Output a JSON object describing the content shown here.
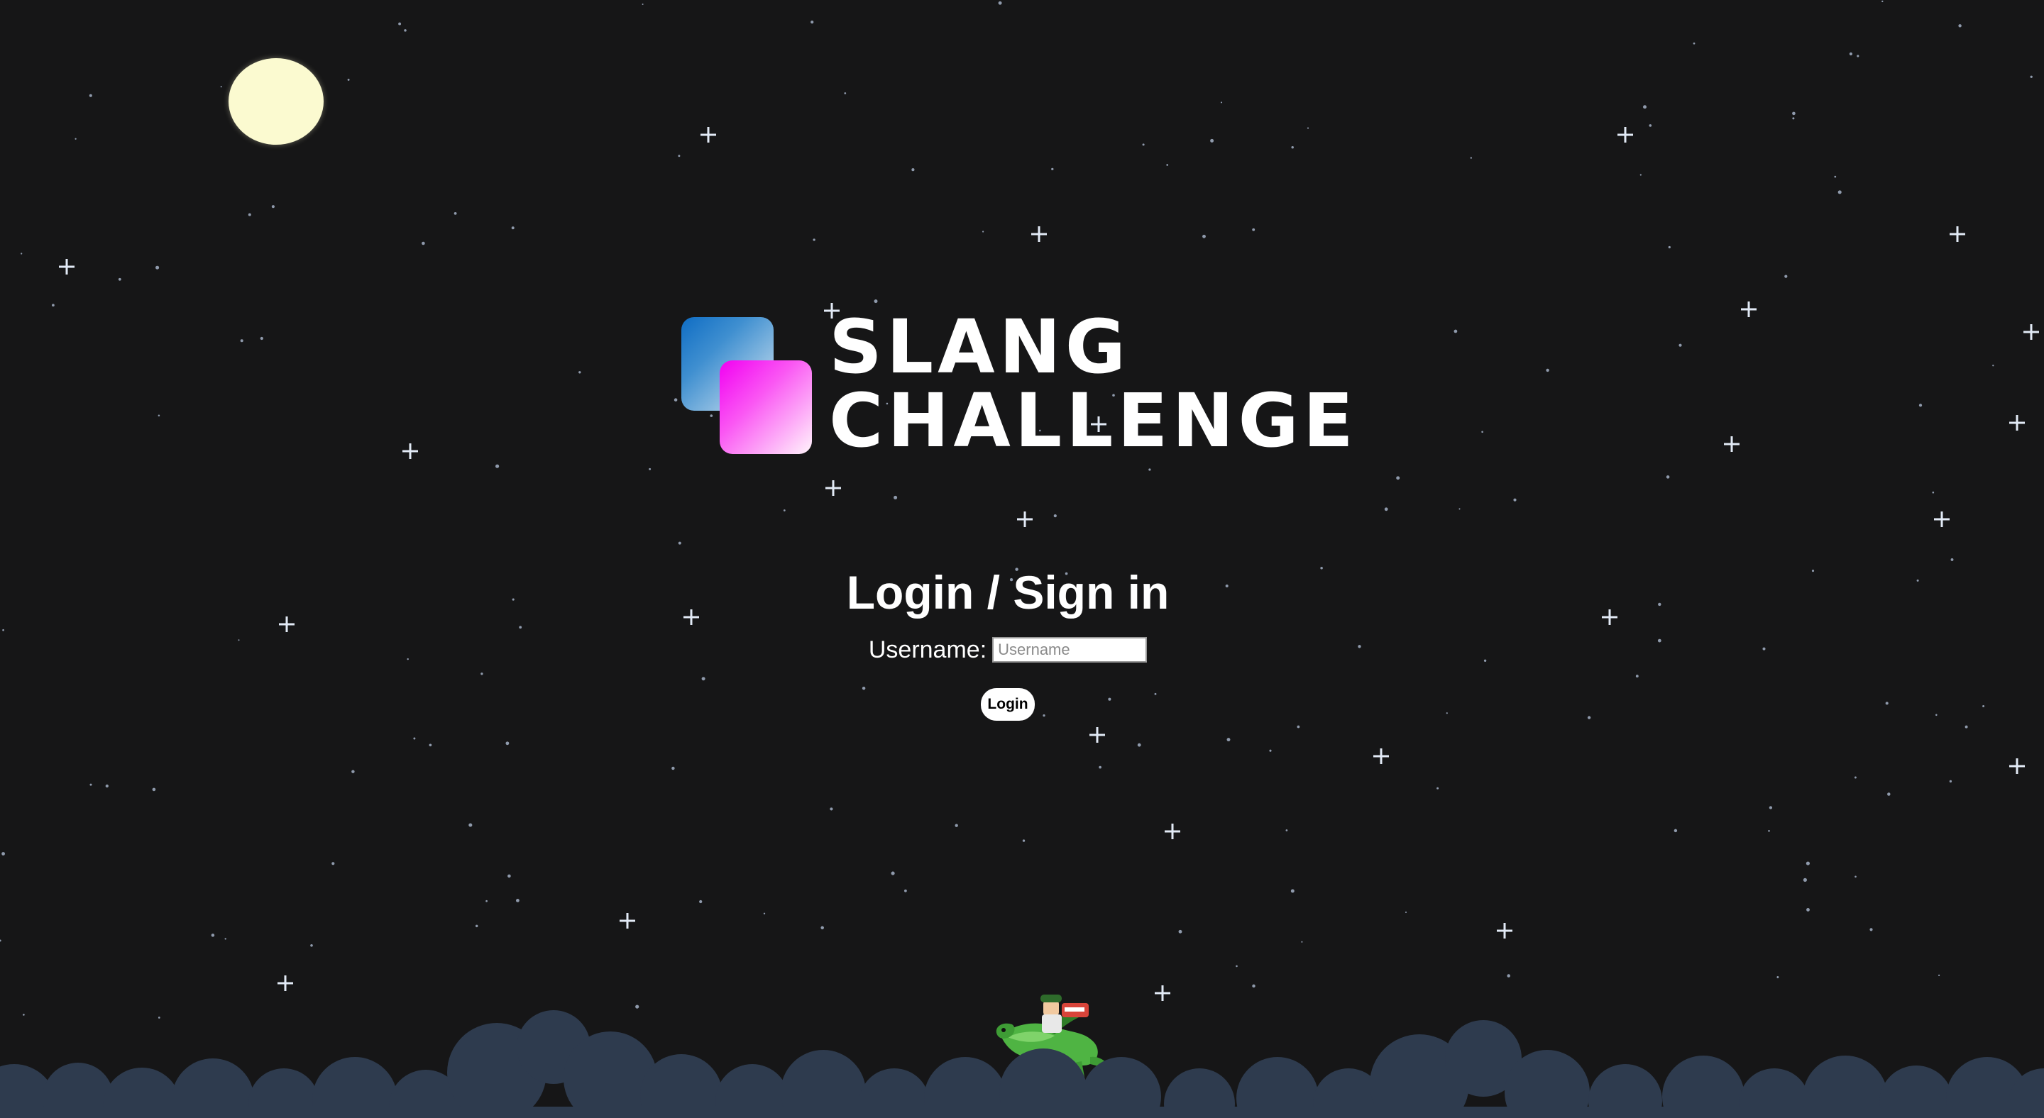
{
  "background": {
    "sky_color": "#161617",
    "moon_color": "#fbfad0",
    "cloud_color": "#2e3b4e",
    "star_color": "#e2eaf6"
  },
  "logo": {
    "line1": "SLANG",
    "line2": "CHALLENGE",
    "square_colors": [
      "#0f6dc4",
      "#f100f2"
    ]
  },
  "login": {
    "title": "Login / Sign in",
    "username_label": "Username:",
    "username_value": "",
    "username_placeholder": "Username",
    "button_label": "Login"
  },
  "decor": {
    "character": "green-dragon-rider-sprite"
  }
}
